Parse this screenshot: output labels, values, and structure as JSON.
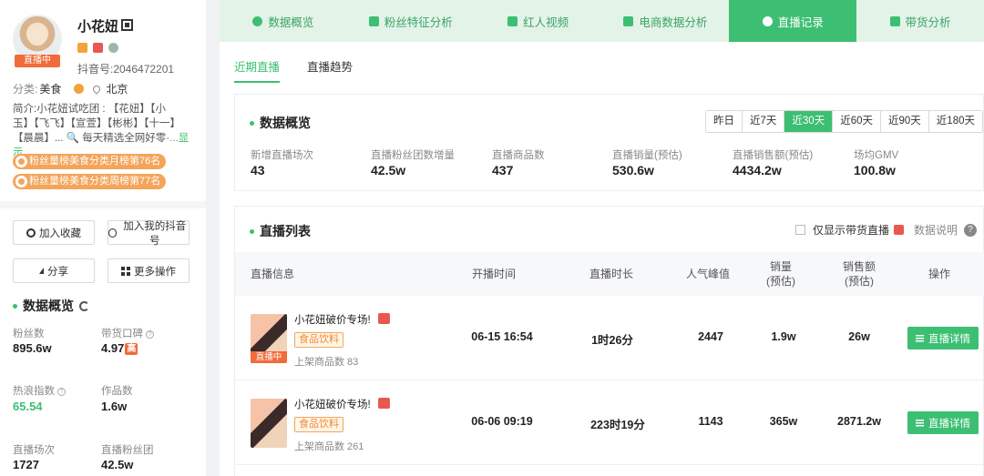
{
  "profile": {
    "name": "小花妞",
    "live_badge": "直播中",
    "douyin_id": "抖音号:2046472201",
    "category_label": "分类:",
    "category_value": "美食",
    "location": "北京",
    "bio_line1": "简介:小花妞试吃团 : 【花妞】【小",
    "bio_line2": "玉】【飞飞】【宣萱】【彬彬】【十一】",
    "bio_line3": "【晨晨】... 🔍 每天精选全网好零·",
    "bio_more": "...显示",
    "rank1": "粉丝量榜美食分类月榜第76名",
    "rank2": "粉丝量榜美食分类周榜第77名"
  },
  "actions": {
    "collect": "加入收藏",
    "add_douyin": "加入我的抖音号",
    "share": "分享",
    "more": "更多操作"
  },
  "overview": {
    "title": "数据概览",
    "fans_label": "粉丝数",
    "fans_value": "895.6w",
    "rep_label": "带货口碑",
    "rep_value": "4.97",
    "rep_badge": "高",
    "hot_label": "热浪指数",
    "hot_value": "65.54",
    "works_label": "作品数",
    "works_value": "1.6w",
    "live_count_label": "直播场次",
    "live_count_value": "1727",
    "fan_group_label": "直播粉丝团",
    "fan_group_value": "42.5w"
  },
  "nav": {
    "tabs": [
      {
        "label": "数据概览"
      },
      {
        "label": "粉丝特征分析"
      },
      {
        "label": "红人视频"
      },
      {
        "label": "电商数据分析"
      },
      {
        "label": "直播记录"
      },
      {
        "label": "带货分析"
      }
    ],
    "active_index": 4
  },
  "subtabs": {
    "recent": "近期直播",
    "trend": "直播趋势"
  },
  "summary": {
    "title": "数据概览",
    "ranges": [
      "昨日",
      "近7天",
      "近30天",
      "近60天",
      "近90天",
      "近180天"
    ],
    "active_range": "近30天",
    "kpis": [
      {
        "label": "新增直播场次",
        "value": "43"
      },
      {
        "label": "直播粉丝团数增量",
        "value": "42.5w"
      },
      {
        "label": "直播商品数",
        "value": "437"
      },
      {
        "label": "直播销量(预估)",
        "value": "530.6w"
      },
      {
        "label": "直播销售额(预估)",
        "value": "4434.2w"
      },
      {
        "label": "场均GMV",
        "value": "100.8w"
      }
    ]
  },
  "live_list": {
    "title": "直播列表",
    "only_goods_label": "仅显示带货直播",
    "data_help": "数据说明",
    "columns": {
      "info": "直播信息",
      "start": "开播时间",
      "duration": "直播时长",
      "peak": "人气峰值",
      "sales_l1": "销量",
      "sales_l2": "(预估)",
      "amount_l1": "销售额",
      "amount_l2": "(预估)",
      "op": "操作"
    },
    "rows": [
      {
        "title": "小花妞破价专场!",
        "live_tag": "直播中",
        "category": "食品饮料",
        "goods": "上架商品数 83",
        "start": "06-15 16:54",
        "duration": "1时26分",
        "peak": "2447",
        "sales": "1.9w",
        "amount": "26w",
        "button": "直播详情"
      },
      {
        "title": "小花妞破价专场!",
        "live_tag": "",
        "category": "食品饮料",
        "goods": "上架商品数 261",
        "start": "06-06 09:19",
        "duration": "223时19分",
        "peak": "1143",
        "sales": "365w",
        "amount": "2871.2w",
        "button": "直播详情"
      }
    ]
  },
  "colors": {
    "accent": "#3cbf72",
    "nav_bg": "#e3f3e8",
    "live_orange": "#f26b3a",
    "rank_orange": "#f3a55b"
  }
}
